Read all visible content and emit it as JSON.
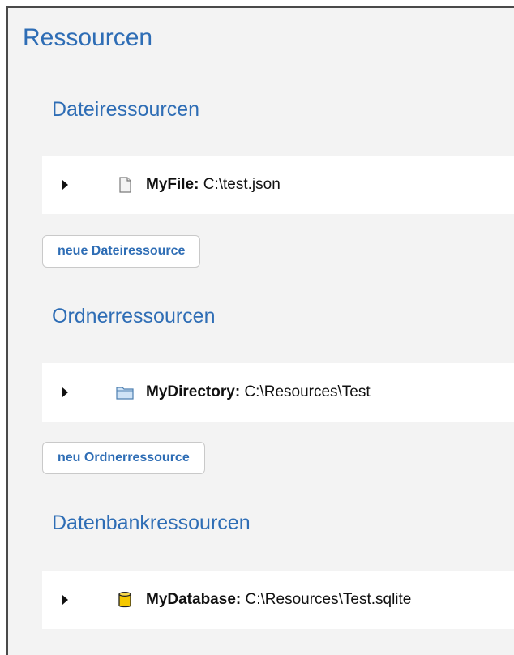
{
  "page": {
    "title": "Ressourcen"
  },
  "sections": [
    {
      "title": "Dateiressourcen",
      "resource": {
        "name": "MyFile:",
        "path": "C:\\test.json",
        "icon": "file-icon"
      },
      "button_label": "neue Dateiressource"
    },
    {
      "title": "Ordnerressourcen",
      "resource": {
        "name": "MyDirectory:",
        "path": "C:\\Resources\\Test",
        "icon": "folder-icon"
      },
      "button_label": "neu Ordnerressource"
    },
    {
      "title": "Datenbankressourcen",
      "resource": {
        "name": "MyDatabase:",
        "path": "C:\\Resources\\Test.sqlite",
        "icon": "database-icon"
      }
    }
  ],
  "colors": {
    "accent": "#2e6db5",
    "panel_background": "#f3f3f3",
    "row_background": "#ffffff",
    "database_icon": "#f5c800"
  }
}
